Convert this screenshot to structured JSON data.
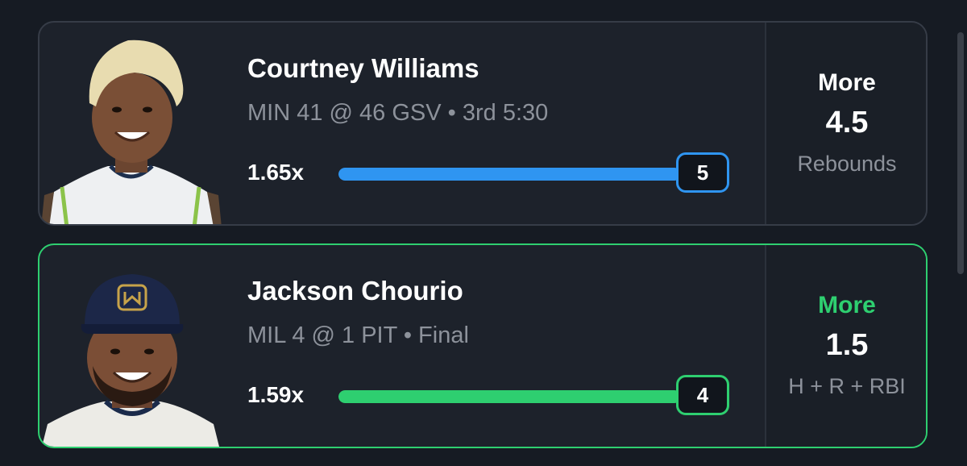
{
  "picks": [
    {
      "player_name": "Courtney Williams",
      "game_info": "MIN 41 @ 46 GSV • 3rd 5:30",
      "multiplier": "1.65x",
      "current_value": "5",
      "progress_fraction": 1.0,
      "direction": "More",
      "line": "4.5",
      "stat_type": "Rebounds",
      "accent_color": "#2f95f1",
      "status": "in-progress"
    },
    {
      "player_name": "Jackson Chourio",
      "game_info": "MIL 4 @ 1 PIT • Final",
      "multiplier": "1.59x",
      "current_value": "4",
      "progress_fraction": 1.0,
      "direction": "More",
      "line": "1.5",
      "stat_type": "H + R + RBI",
      "accent_color": "#2ecf70",
      "status": "won"
    }
  ],
  "colors": {
    "background": "#161b23",
    "card": "#1d222b",
    "blue": "#2f95f1",
    "green": "#2ecf70",
    "muted_text": "#8d929b"
  }
}
